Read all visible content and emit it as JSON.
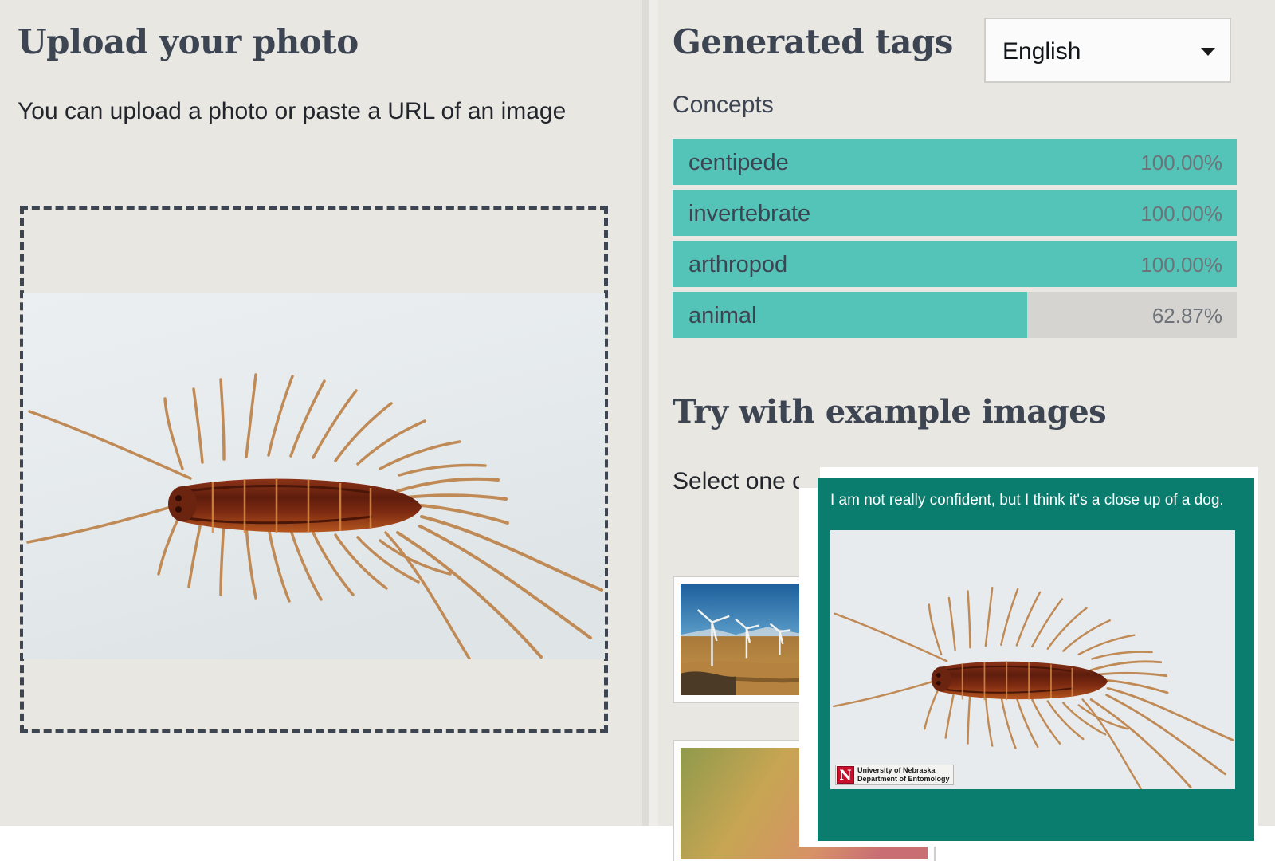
{
  "upload": {
    "title": "Upload your photo",
    "description": "You can upload a photo or paste a URL of an image",
    "dropzone_name": "photo-dropzone"
  },
  "tags_panel": {
    "title": "Generated tags",
    "language": {
      "selected": "English",
      "caret_icon": "chevron-down-icon"
    },
    "concepts_label": "Concepts",
    "concepts": [
      {
        "label": "centipede",
        "score": "100.00%",
        "value": 100.0
      },
      {
        "label": "invertebrate",
        "score": "100.00%",
        "value": 100.0
      },
      {
        "label": "arthropod",
        "score": "100.00%",
        "value": 100.0
      },
      {
        "label": "animal",
        "score": "62.87%",
        "value": 62.87
      }
    ]
  },
  "examples": {
    "title": "Try with example images",
    "description": "Select one of the following to see the results",
    "thumbnails": [
      {
        "name": "wind-turbines-thumbnail"
      },
      {
        "name": "landscape-thumbnail"
      }
    ]
  },
  "popup": {
    "caption": "I am not really confident, but I think it's a close up of a dog.",
    "watermark_line1": "University of Nebraska",
    "watermark_line2": "Department of Entomology",
    "watermark_logo": "N"
  },
  "colors": {
    "page_background": "#e9e7e2",
    "heading": "#3d4452",
    "bar_fill": "#55c4b8",
    "bar_track": "#d6d4d1",
    "popup_background": "#0a7d6e",
    "watermark_logo": "#c8102e"
  }
}
